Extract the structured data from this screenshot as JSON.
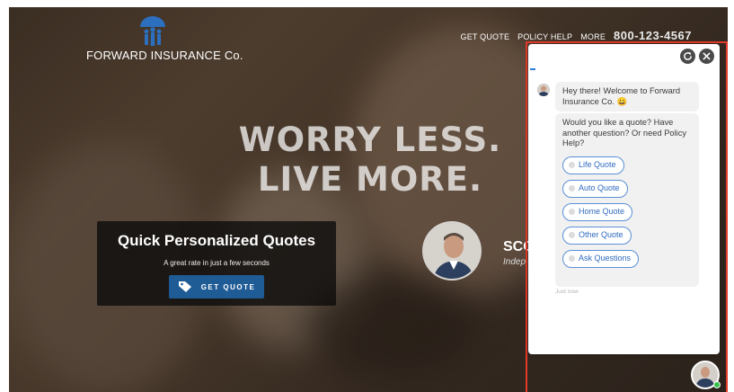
{
  "brand": {
    "name": "FORWARD INSURANCE Co."
  },
  "nav": {
    "items": [
      "GET QUOTE",
      "POLICY HELP",
      "MORE"
    ],
    "phone": "800-123-4567"
  },
  "hero": {
    "line1": "WORRY LESS.",
    "line2": "LIVE MORE."
  },
  "quote_box": {
    "title": "Quick Personalized Quotes",
    "subtitle": "A great rate in just a few seconds",
    "button": "GET QUOTE"
  },
  "agent": {
    "name": "SCO",
    "title": "Indep"
  },
  "chat": {
    "greeting": "Hey there! Welcome to Forward Insurance Co. 😀",
    "question": "Would you like a quote? Have another question? Or need Policy Help?",
    "options": [
      "Life Quote",
      "Auto Quote",
      "Home Quote",
      "Other Quote",
      "Ask Questions"
    ],
    "timestamp": "Just now",
    "refresh_icon": "refresh-icon",
    "close_icon": "close-icon"
  },
  "colors": {
    "accent": "#1f5b95",
    "chat_option": "#2f6bc0",
    "highlight_border": "#e03a2a",
    "online": "#35c24a"
  }
}
